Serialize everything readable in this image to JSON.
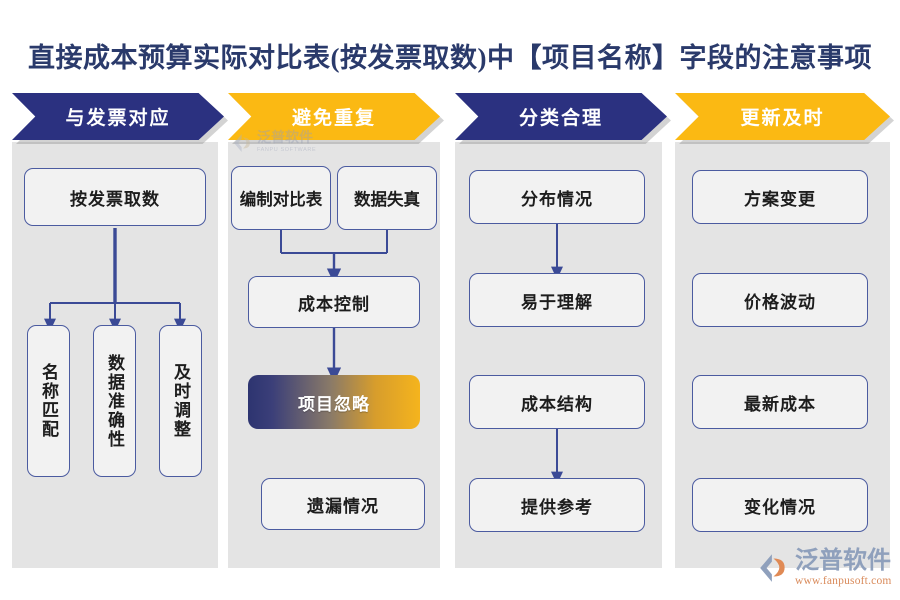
{
  "page": {
    "title": "直接成本预算实际对比表(按发票取数)中【项目名称】字段的注意事项",
    "title_color": "#2a3a6b",
    "background": "#ffffff"
  },
  "colors": {
    "navy": "#2b3180",
    "gold": "#fbb913",
    "panel": "#e4e4e4",
    "node_fill": "#f2f2f2",
    "node_border": "#4b5ba0",
    "connector": "#3b4a96",
    "gradient_start": "#2d3470",
    "gradient_end": "#f5b41d"
  },
  "columns": [
    {
      "id": "col-1",
      "banner": {
        "label": "与发票对应",
        "style": "navy"
      },
      "nodes": [
        {
          "id": "c1-n1",
          "label": "按发票取数",
          "orientation": "horizontal",
          "style": "plain"
        },
        {
          "id": "c1-n2",
          "label": "名称匹配",
          "orientation": "vertical",
          "style": "plain"
        },
        {
          "id": "c1-n3",
          "label": "数据准确性",
          "orientation": "vertical",
          "style": "plain"
        },
        {
          "id": "c1-n4",
          "label": "及时调整",
          "orientation": "vertical",
          "style": "plain"
        }
      ]
    },
    {
      "id": "col-2",
      "banner": {
        "label": "避免重复",
        "style": "gold"
      },
      "nodes": [
        {
          "id": "c2-n1",
          "label": "编制对比表",
          "orientation": "horizontal",
          "style": "plain"
        },
        {
          "id": "c2-n2",
          "label": "数据失真",
          "orientation": "horizontal",
          "style": "plain"
        },
        {
          "id": "c2-n3",
          "label": "成本控制",
          "orientation": "horizontal",
          "style": "plain"
        },
        {
          "id": "c2-n4",
          "label": "项目忽略",
          "orientation": "horizontal",
          "style": "gradient"
        },
        {
          "id": "c2-n5",
          "label": "遗漏情况",
          "orientation": "horizontal",
          "style": "plain"
        }
      ]
    },
    {
      "id": "col-3",
      "banner": {
        "label": "分类合理",
        "style": "navy"
      },
      "nodes": [
        {
          "id": "c3-n1",
          "label": "分布情况",
          "orientation": "horizontal",
          "style": "plain"
        },
        {
          "id": "c3-n2",
          "label": "易于理解",
          "orientation": "horizontal",
          "style": "plain"
        },
        {
          "id": "c3-n3",
          "label": "成本结构",
          "orientation": "horizontal",
          "style": "plain"
        },
        {
          "id": "c3-n4",
          "label": "提供参考",
          "orientation": "horizontal",
          "style": "plain"
        }
      ]
    },
    {
      "id": "col-4",
      "banner": {
        "label": "更新及时",
        "style": "gold"
      },
      "nodes": [
        {
          "id": "c4-n1",
          "label": "方案变更",
          "orientation": "horizontal",
          "style": "plain"
        },
        {
          "id": "c4-n2",
          "label": "价格波动",
          "orientation": "horizontal",
          "style": "plain"
        },
        {
          "id": "c4-n3",
          "label": "最新成本",
          "orientation": "horizontal",
          "style": "plain"
        },
        {
          "id": "c4-n4",
          "label": "变化情况",
          "orientation": "horizontal",
          "style": "plain"
        }
      ]
    }
  ],
  "watermark": {
    "cn": "泛普软件",
    "en": "FANPU SOFTWARE"
  },
  "logo": {
    "cn": "泛普软件",
    "url": "www.fanpusoft.com"
  }
}
